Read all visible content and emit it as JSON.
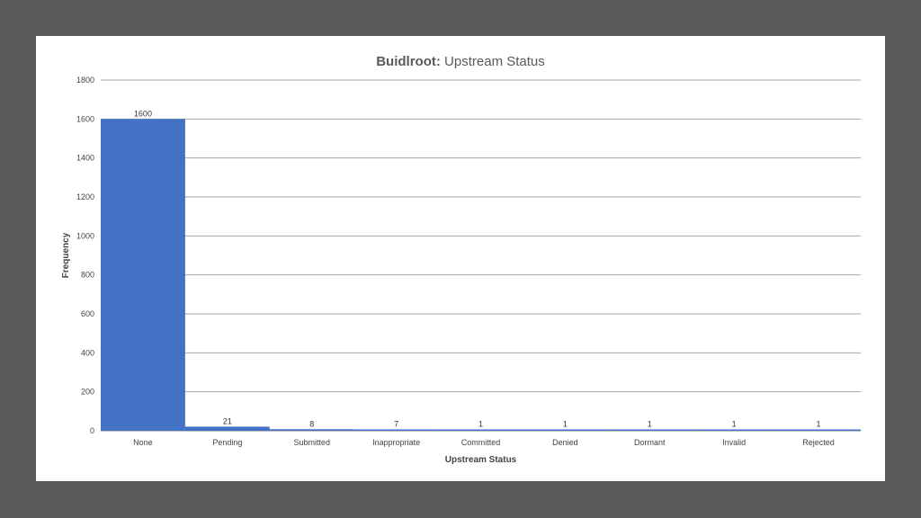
{
  "chart_data": {
    "type": "bar",
    "title_bold": "Buidlroot:",
    "title_rest": "Upstream Status",
    "xlabel": "Upstream Status",
    "ylabel": "Frequency",
    "categories": [
      "None",
      "Pending",
      "Submitted",
      "Inappropriate",
      "Committed",
      "Denied",
      "Dormant",
      "Invalid",
      "Rejected"
    ],
    "values": [
      1600,
      21,
      8,
      7,
      1,
      1,
      1,
      1,
      1
    ],
    "data_labels": [
      "1600",
      "21",
      "8",
      "7",
      "1",
      "1",
      "1",
      "1",
      "1"
    ],
    "ylim": [
      0,
      1800
    ],
    "yticks": [
      0,
      200,
      400,
      600,
      800,
      1000,
      1200,
      1400,
      1600,
      1800
    ],
    "grid": true,
    "legend": "none",
    "bar_color": "#4472c4"
  }
}
